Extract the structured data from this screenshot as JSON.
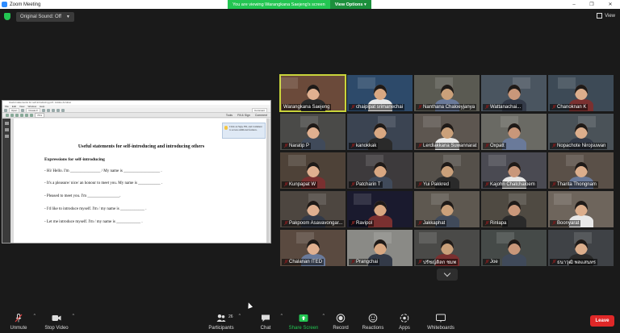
{
  "window": {
    "title": "Zoom Meeting",
    "minimize": "–",
    "maximize": "❐",
    "close": "✕"
  },
  "banner": {
    "message": "You are viewing Warangkana Saejeng's screen",
    "view_options": "View Options ▾"
  },
  "topbar": {
    "original_sound": "Original Sound: Off",
    "view": "View"
  },
  "pdf": {
    "window_title": "Useful statements for self-introducing.pdf - Adobe Acrobat",
    "menu": [
      "File",
      "Edit",
      "View",
      "Window",
      "Help"
    ],
    "open": "Open",
    "create": "Create ▾",
    "zoom": "76%",
    "comment": "Comment",
    "tools": "Tools",
    "fill_sign": "Fill & Sign",
    "comment_tab": "Comment",
    "tip": "Click on Sign, Fill, and Comment to access additional features.",
    "heading": "Useful statements for self-introducing and introducing others",
    "subheading": "Expressions for self-introducing",
    "lines": [
      "- Hi/ Hello. I'm _______________ / My name is __________________ .",
      "- It's a pleasure/ nice/ an honour to meet you. My name is ___________ .",
      "- Pleased to meet you. I'm ________________.",
      "- I'd like to introduce myself. I'm / my name is ____________ .",
      "- Let me introduce myself. I'm / my name is ____________ ."
    ]
  },
  "participants": [
    {
      "name": "Warangkana Saejeng",
      "muted": false
    },
    {
      "name": "chaipipat srimanechai",
      "muted": true
    },
    {
      "name": "Nanthana Chaloeyjanya",
      "muted": true
    },
    {
      "name": "Wattanachai...",
      "muted": true
    },
    {
      "name": "Chanoknan K",
      "muted": true
    },
    {
      "name": "Naratip P",
      "muted": true
    },
    {
      "name": "kanokkak",
      "muted": true
    },
    {
      "name": "Lerdlakkana Suwannarat",
      "muted": true
    },
    {
      "name": "Oxpatt",
      "muted": true
    },
    {
      "name": "Nopachote Nirojsuwan",
      "muted": true
    },
    {
      "name": "Kunpapat W",
      "muted": true
    },
    {
      "name": "Patcharin T",
      "muted": true
    },
    {
      "name": "Yui Pakkred",
      "muted": true
    },
    {
      "name": "Kajohn Chatchaloem",
      "muted": true
    },
    {
      "name": "Tharita Thongnam",
      "muted": true
    },
    {
      "name": "Pakpoom Asavavongar...",
      "muted": true
    },
    {
      "name": "Ravipol",
      "muted": true
    },
    {
      "name": "Jakkaphat",
      "muted": true
    },
    {
      "name": "Rinlapa",
      "muted": true
    },
    {
      "name": "Boonyarat",
      "muted": true
    },
    {
      "name": "Chalanan ITED",
      "muted": true
    },
    {
      "name": "Prangchai",
      "muted": true
    },
    {
      "name": "ปรัชญ์ดิลก ชมพ",
      "muted": true
    },
    {
      "name": "Joe",
      "muted": true
    },
    {
      "name": "ธนาวุฒิ พลแสนทร",
      "muted": true
    }
  ],
  "toolbar": {
    "unmute": "Unmute",
    "stop_video": "Stop Video",
    "participants": "Participants",
    "participants_count": "26",
    "chat": "Chat",
    "share_screen": "Share Screen",
    "record": "Record",
    "reactions": "Reactions",
    "apps": "Apps",
    "whiteboards": "Whiteboards",
    "leave": "Leave"
  },
  "colors": {
    "share_green": "#23c552",
    "leave_red": "#e02828",
    "active_speaker": "#c9d43b"
  }
}
